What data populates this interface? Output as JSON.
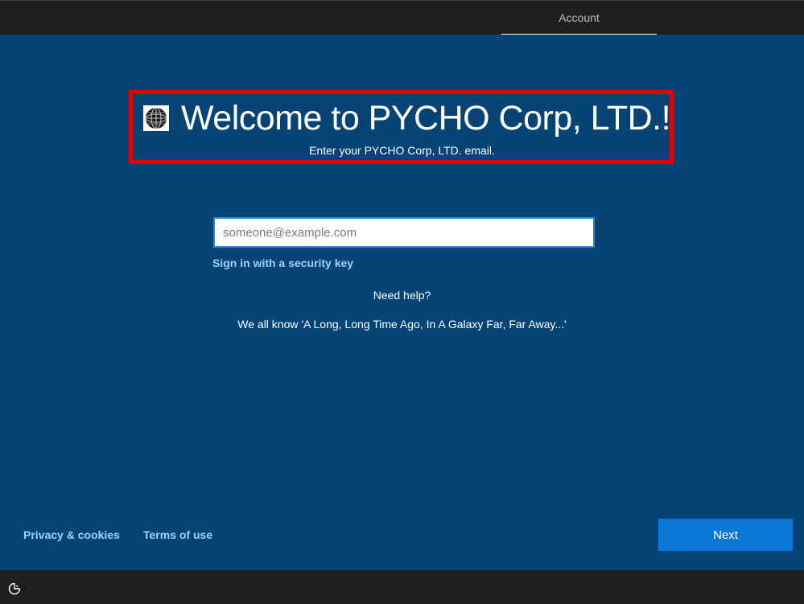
{
  "header": {
    "tab_label": "Account"
  },
  "welcome": {
    "title": "Welcome to PYCHO Corp, LTD.!",
    "subtitle": "Enter your PYCHO Corp, LTD. email.",
    "logo_icon": "globe-logo-icon",
    "highlight_color": "#e50000"
  },
  "form": {
    "email_placeholder": "someone@example.com",
    "email_value": "",
    "security_key_link": "Sign in with a security key",
    "need_help": "Need help?",
    "help_text": "We all know 'A Long, Long Time Ago, In A Galaxy Far, Far Away...'"
  },
  "footer": {
    "privacy_link": "Privacy & cookies",
    "terms_link": "Terms of use",
    "next_label": "Next"
  },
  "taskbar": {
    "ease_icon": "ease-of-access-icon"
  },
  "colors": {
    "background": "#054475",
    "accent": "#0a78d7",
    "link": "#9fd0ff"
  }
}
